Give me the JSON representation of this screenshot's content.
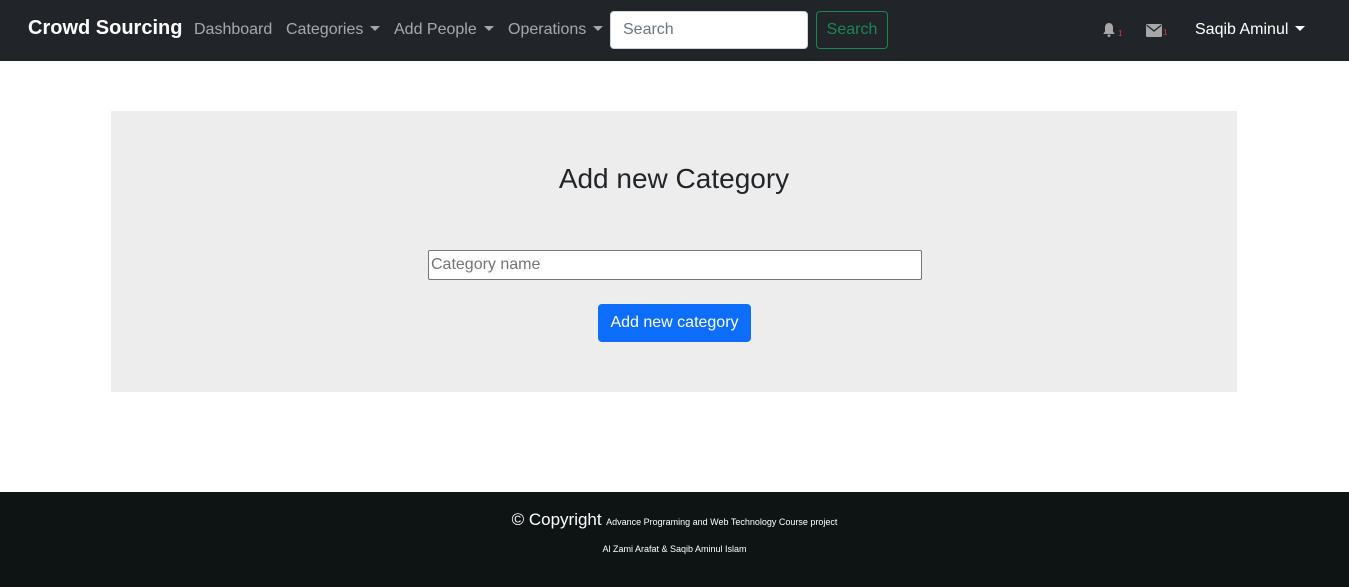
{
  "navbar": {
    "brand": "Crowd Sourcing",
    "links": {
      "dashboard": "Dashboard",
      "categories": "Categories",
      "add_people": "Add People",
      "operations": "Operations"
    },
    "search": {
      "placeholder": "Search",
      "button_label": "Search"
    },
    "icons": {
      "notifications": "bell-icon",
      "messages": "envelope-icon"
    },
    "notification_count": "1",
    "message_count": "1",
    "user_name": "Saqib Aminul"
  },
  "main": {
    "title": "Add new Category",
    "category_input_placeholder": "Category name",
    "submit_label": "Add new category"
  },
  "footer": {
    "copyright": "© Copyright",
    "project": "Advance Programing and Web Technology Course project",
    "authors": "Al Zami Arafat & Saqib Aminul Islam"
  },
  "colors": {
    "navbar_bg": "#212529",
    "card_bg": "#ededed",
    "primary": "#0d6efd",
    "success": "#198754",
    "footer_bg": "#0e1414",
    "badge": "#dc3545"
  }
}
